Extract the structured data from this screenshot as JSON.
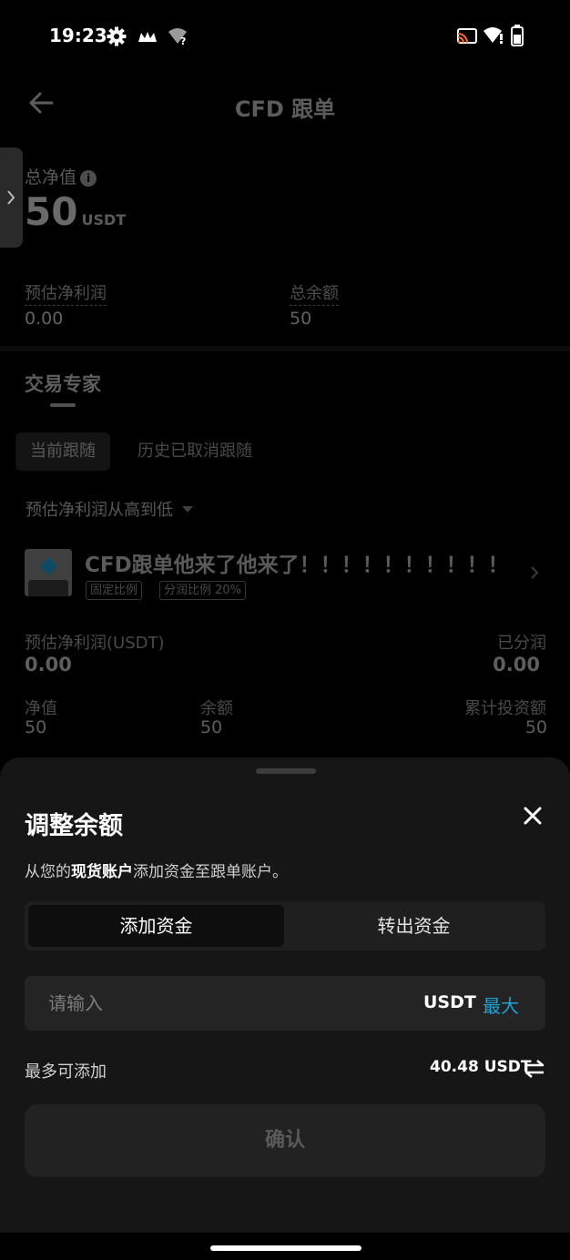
{
  "status_bar": {
    "time": "19:23",
    "icons": [
      "gear-icon",
      "crown-icon",
      "wifi-question-icon",
      "cast-icon",
      "wifi-alert-icon",
      "battery-icon"
    ]
  },
  "header": {
    "title": "CFD 跟单",
    "back_icon": "arrow-left-icon"
  },
  "summary": {
    "net_value_label": "总净值",
    "net_value": "50",
    "net_value_unit": "USDT",
    "est_profit_label": "预估净利润",
    "est_profit_value": "0.00",
    "total_balance_label": "总余额",
    "total_balance_value": "50"
  },
  "experts": {
    "section_title": "交易专家",
    "tabs": [
      {
        "label": "当前跟随",
        "active": true
      },
      {
        "label": "历史已取消跟随",
        "active": false
      }
    ],
    "sort_label": "预估净利润从高到低",
    "card": {
      "name": "CFD跟单他来了他来了！！！！！！！！！！",
      "tags": [
        "固定比例",
        "分润比例 20%"
      ],
      "est_profit_label": "预估净利润(USDT)",
      "est_profit_value": "0.00",
      "shared_label": "已分润",
      "shared_value": "0.00",
      "net_label": "净值",
      "net_value": "50",
      "balance_label": "余额",
      "balance_value": "50",
      "invested_label": "累计投资额",
      "invested_value": "50"
    }
  },
  "sheet": {
    "title": "调整余额",
    "desc_prefix": "从您的",
    "desc_bold": "现货账户",
    "desc_suffix": "添加资金至跟单账户。",
    "toggle_add": "添加资金",
    "toggle_out": "转出资金",
    "amount_placeholder": "请输入",
    "amount_unit": "USDT",
    "max_label": "最大",
    "limit_label": "最多可添加",
    "limit_value": "40.48 USDT",
    "confirm_label": "确认",
    "accent_color": "#1fa3d6"
  }
}
